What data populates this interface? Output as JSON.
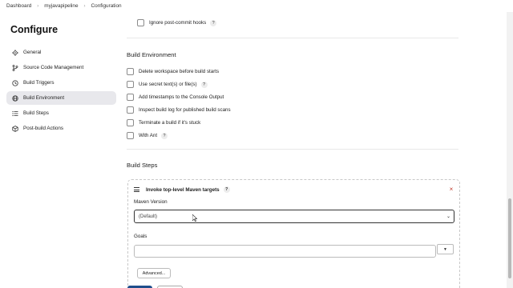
{
  "breadcrumb": [
    {
      "label": "Dashboard"
    },
    {
      "label": "myjavapipeline"
    },
    {
      "label": "Configuration"
    }
  ],
  "page": {
    "title": "Configure"
  },
  "sidebar": {
    "items": [
      {
        "label": "General",
        "icon": "gear-icon"
      },
      {
        "label": "Source Code Management",
        "icon": "branch-icon"
      },
      {
        "label": "Build Triggers",
        "icon": "clock-icon"
      },
      {
        "label": "Build Environment",
        "icon": "globe-icon",
        "active": true
      },
      {
        "label": "Build Steps",
        "icon": "list-icon"
      },
      {
        "label": "Post-build Actions",
        "icon": "cube-icon"
      }
    ]
  },
  "triggers_tail": {
    "ignore_hooks_label": "Ignore post-commit hooks"
  },
  "build_environment": {
    "title": "Build Environment",
    "options": [
      {
        "label": "Delete workspace before build starts",
        "help": false
      },
      {
        "label": "Use secret text(s) or file(s)",
        "help": true
      },
      {
        "label": "Add timestamps to the Console Output",
        "help": false
      },
      {
        "label": "Inspect build log for published build scans",
        "help": false
      },
      {
        "label": "Terminate a build if it's stuck",
        "help": false
      },
      {
        "label": "With Ant",
        "help": true
      }
    ]
  },
  "build_steps": {
    "title": "Build Steps",
    "step": {
      "title": "Invoke top-level Maven targets",
      "maven_version_label": "Maven Version",
      "maven_version_value": "(Default)",
      "goals_label": "Goals",
      "goals_value": "",
      "advanced_label": "Advanced..."
    }
  },
  "help_glyph": "?",
  "close_glyph": "×",
  "caret_glyph": "⌄",
  "expand_glyph": "▼",
  "colors": {
    "accent": "#1f4e8c",
    "close": "#c0392b",
    "active_bg": "#e8e8ec"
  }
}
